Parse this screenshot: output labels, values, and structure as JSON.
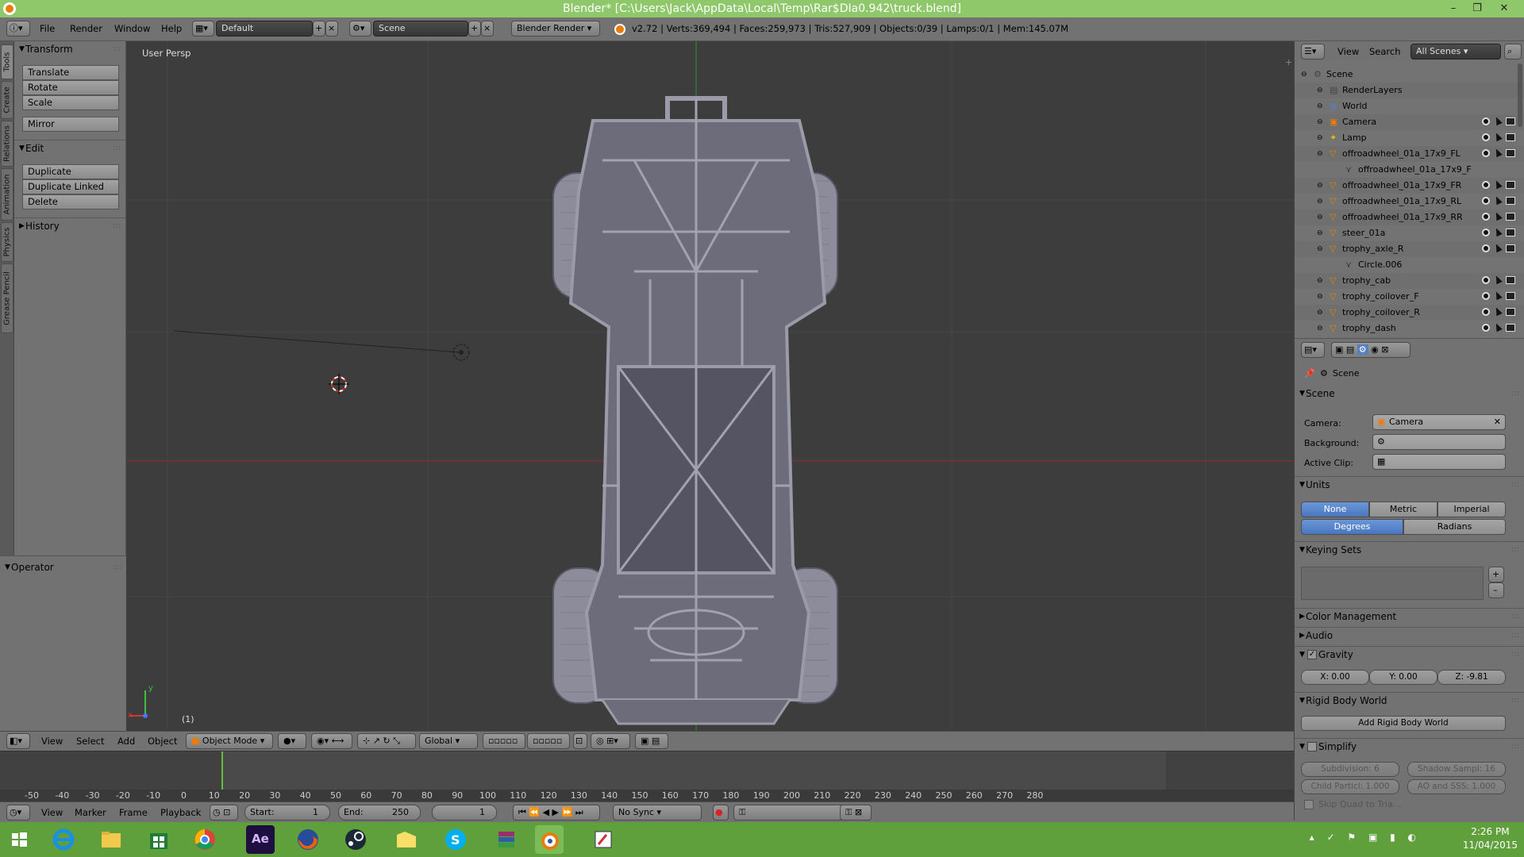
{
  "window": {
    "title": "Blender* [C:\\Users\\Jack\\AppData\\Local\\Temp\\Rar$DIa0.942\\truck.blend]",
    "minimize": "–",
    "restore": "❐",
    "close": "✕"
  },
  "info_header": {
    "menus": [
      "File",
      "Render",
      "Window",
      "Help"
    ],
    "screen_layout": "Default",
    "scene": "Scene",
    "render_engine": "Blender Render",
    "stats": "v2.72 | Verts:369,494 | Faces:259,973 | Tris:527,909 | Objects:0/39 | Lamps:0/1 | Mem:145.07M"
  },
  "tool_tabs": [
    "Tools",
    "Create",
    "Relations",
    "Animation",
    "Physics",
    "Grease Pencil"
  ],
  "tool_shelf": {
    "transform_header": "Transform",
    "transform_buttons": [
      "Translate",
      "Rotate",
      "Scale"
    ],
    "mirror": "Mirror",
    "edit_header": "Edit",
    "edit_buttons": [
      "Duplicate",
      "Duplicate Linked",
      "Delete"
    ],
    "history_header": "History",
    "operator_header": "Operator"
  },
  "viewport": {
    "label": "User Persp",
    "frame_indicator": "(1)",
    "axis_x": "x",
    "axis_y": "y"
  },
  "viewport_header": {
    "menus": [
      "View",
      "Select",
      "Add",
      "Object"
    ],
    "mode": "Object Mode",
    "orientation": "Global"
  },
  "timeline": {
    "ruler": [
      "-50",
      "-40",
      "-30",
      "-20",
      "-10",
      "0",
      "10",
      "20",
      "30",
      "40",
      "50",
      "60",
      "70",
      "80",
      "90",
      "100",
      "110",
      "120",
      "130",
      "140",
      "150",
      "160",
      "170",
      "180",
      "190",
      "200",
      "210",
      "220",
      "230",
      "240",
      "250",
      "260",
      "270",
      "280"
    ],
    "menus": [
      "View",
      "Marker",
      "Frame",
      "Playback"
    ],
    "start_label": "Start:",
    "start_value": "1",
    "end_label": "End:",
    "end_value": "250",
    "current_frame": "1",
    "sync": "No Sync"
  },
  "outliner": {
    "menus": [
      "View",
      "Search"
    ],
    "filter": "All Scenes",
    "rows": [
      {
        "indent": 0,
        "label": "Scene",
        "icon": "scene-icon"
      },
      {
        "indent": 1,
        "label": "RenderLayers",
        "icon": "renderlayers-icon"
      },
      {
        "indent": 1,
        "label": "World",
        "icon": "world-icon"
      },
      {
        "indent": 1,
        "label": "Camera",
        "icon": "camera-object-icon"
      },
      {
        "indent": 1,
        "label": "Lamp",
        "icon": "lamp-icon"
      },
      {
        "indent": 1,
        "label": "offroadwheel_01a_17x9_FL",
        "icon": "mesh-object-icon"
      },
      {
        "indent": 2,
        "label": "offroadwheel_01a_17x9_F",
        "icon": "mesh-data-icon"
      },
      {
        "indent": 1,
        "label": "offroadwheel_01a_17x9_FR",
        "icon": "mesh-object-icon"
      },
      {
        "indent": 1,
        "label": "offroadwheel_01a_17x9_RL",
        "icon": "mesh-object-icon"
      },
      {
        "indent": 1,
        "label": "offroadwheel_01a_17x9_RR",
        "icon": "mesh-object-icon"
      },
      {
        "indent": 1,
        "label": "steer_01a",
        "icon": "mesh-object-icon"
      },
      {
        "indent": 1,
        "label": "trophy_axle_R",
        "icon": "mesh-object-icon"
      },
      {
        "indent": 2,
        "label": "Circle.006",
        "icon": "mesh-data-icon"
      },
      {
        "indent": 1,
        "label": "trophy_cab",
        "icon": "mesh-object-icon"
      },
      {
        "indent": 1,
        "label": "trophy_coilover_F",
        "icon": "mesh-object-icon"
      },
      {
        "indent": 1,
        "label": "trophy_coilover_R",
        "icon": "mesh-object-icon"
      },
      {
        "indent": 1,
        "label": "trophy_dash",
        "icon": "mesh-object-icon"
      }
    ]
  },
  "properties": {
    "context": "Scene",
    "scene_panel": "Scene",
    "camera_label": "Camera:",
    "camera_value": "Camera",
    "background_label": "Background:",
    "active_clip_label": "Active Clip:",
    "units_panel": "Units",
    "units": [
      "None",
      "Metric",
      "Imperial"
    ],
    "rotation": [
      "Degrees",
      "Radians"
    ],
    "keying_sets_panel": "Keying Sets",
    "color_management_panel": "Color Management",
    "audio_panel": "Audio",
    "gravity_panel": "Gravity",
    "gravity_x": "X:",
    "gravity_x_value": "0.00",
    "gravity_y": "Y:",
    "gravity_y_value": "0.00",
    "gravity_z": "Z:",
    "gravity_z_value": "-9.81",
    "rigid_body_panel": "Rigid Body World",
    "add_rigid_body": "Add Rigid Body World",
    "simplify_panel": "Simplify",
    "subdivision": "Subdivision:",
    "subdivision_value": "6",
    "shadow_samples": "Shadow Sampl: 16",
    "child_particles": "Child Particl: 1.000",
    "ao_sss": "AO and SSS: 1.000",
    "skip_quad": "Skip Quad to Tria..."
  },
  "taskbar": {
    "time": "2:26 PM",
    "date": "11/04/2015"
  },
  "colors": {
    "title_green": "#8ec86a",
    "taskbar_green": "#5fa03c",
    "viewport_bg": "#3d3d3d",
    "selected_blue": "#5680c2"
  }
}
